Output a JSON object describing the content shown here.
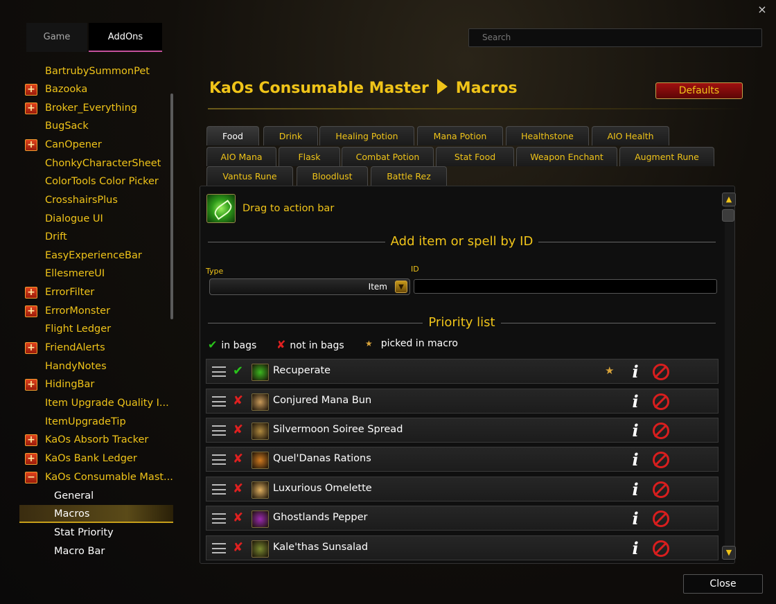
{
  "window": {
    "close_icon": "×"
  },
  "top_tabs": {
    "game": "Game",
    "addons": "AddOns"
  },
  "search": {
    "placeholder": "Search"
  },
  "sidebar": {
    "items": [
      {
        "label": "BartrubySummonPet",
        "expandable": false
      },
      {
        "label": "Bazooka",
        "expandable": true
      },
      {
        "label": "Broker_Everything",
        "expandable": true
      },
      {
        "label": "BugSack",
        "expandable": false
      },
      {
        "label": "CanOpener",
        "expandable": true
      },
      {
        "label": "ChonkyCharacterSheet",
        "expandable": false
      },
      {
        "label": "ColorTools Color Picker",
        "expandable": false
      },
      {
        "label": "CrosshairsPlus",
        "expandable": false
      },
      {
        "label": "Dialogue UI",
        "expandable": false
      },
      {
        "label": "Drift",
        "expandable": false
      },
      {
        "label": "EasyExperienceBar",
        "expandable": false
      },
      {
        "label": "EllesmereUI",
        "expandable": false
      },
      {
        "label": "ErrorFilter",
        "expandable": true
      },
      {
        "label": "ErrorMonster",
        "expandable": true
      },
      {
        "label": "Flight Ledger",
        "expandable": false
      },
      {
        "label": "FriendAlerts",
        "expandable": true
      },
      {
        "label": "HandyNotes",
        "expandable": false
      },
      {
        "label": "HidingBar",
        "expandable": true
      },
      {
        "label": "Item Upgrade Quality I...",
        "expandable": false
      },
      {
        "label": "ItemUpgradeTip",
        "expandable": false
      },
      {
        "label": "KaOs Absorb Tracker",
        "expandable": true
      },
      {
        "label": "KaOs Bank Ledger",
        "expandable": true
      },
      {
        "label": "KaOs Consumable Mast...",
        "expandable": true,
        "expanded": true
      }
    ],
    "subitems": [
      "General",
      "Macros",
      "Stat Priority",
      "Macro Bar"
    ],
    "active_subitem": "Macros",
    "expand_icon": "+",
    "collapse_icon": "−"
  },
  "header": {
    "title_part1": "KaOs Consumable Master",
    "title_part2": "Macros",
    "defaults_label": "Defaults"
  },
  "category_tabs": {
    "row1": [
      "Food",
      "Drink",
      "Healing Potion",
      "Mana Potion",
      "Healthstone",
      "AIO Health"
    ],
    "row2": [
      "AIO Mana",
      "Flask",
      "Combat Potion",
      "Stat Food",
      "Weapon Enchant",
      "Augment Rune"
    ],
    "row3": [
      "Vantus Rune",
      "Bloodlust",
      "Battle Rez"
    ],
    "selected": "Food"
  },
  "drag": {
    "label": "Drag to action bar",
    "icon": "leaf-icon"
  },
  "add_section": {
    "heading": "Add item or spell by ID",
    "type_label": "Type",
    "type_value": "Item",
    "id_label": "ID"
  },
  "priority": {
    "heading": "Priority list",
    "legend_in_bags": "in bags",
    "legend_not_in_bags": "not in bags",
    "legend_picked": "picked in macro",
    "rows": [
      {
        "name": "Recuperate",
        "in_bags": true,
        "picked": true,
        "icon_color": "#3cb820"
      },
      {
        "name": "Conjured Mana Bun",
        "in_bags": false,
        "picked": false,
        "icon_color": "#c89a5a"
      },
      {
        "name": "Silvermoon Soiree Spread",
        "in_bags": false,
        "picked": false,
        "icon_color": "#b08a40"
      },
      {
        "name": "Quel'Danas Rations",
        "in_bags": false,
        "picked": false,
        "icon_color": "#d07a20"
      },
      {
        "name": "Luxurious Omelette",
        "in_bags": false,
        "picked": false,
        "icon_color": "#e0b060"
      },
      {
        "name": "Ghostlands Pepper",
        "in_bags": false,
        "picked": false,
        "icon_color": "#9a2ab0"
      },
      {
        "name": "Kale'thas Sunsalad",
        "in_bags": false,
        "picked": false,
        "icon_color": "#7a8a30"
      }
    ]
  },
  "footer": {
    "close_label": "Close"
  },
  "colors": {
    "accent": "#f0c419",
    "check": "#29c41a",
    "cross": "#e02020",
    "delete": "#d81e1e"
  }
}
